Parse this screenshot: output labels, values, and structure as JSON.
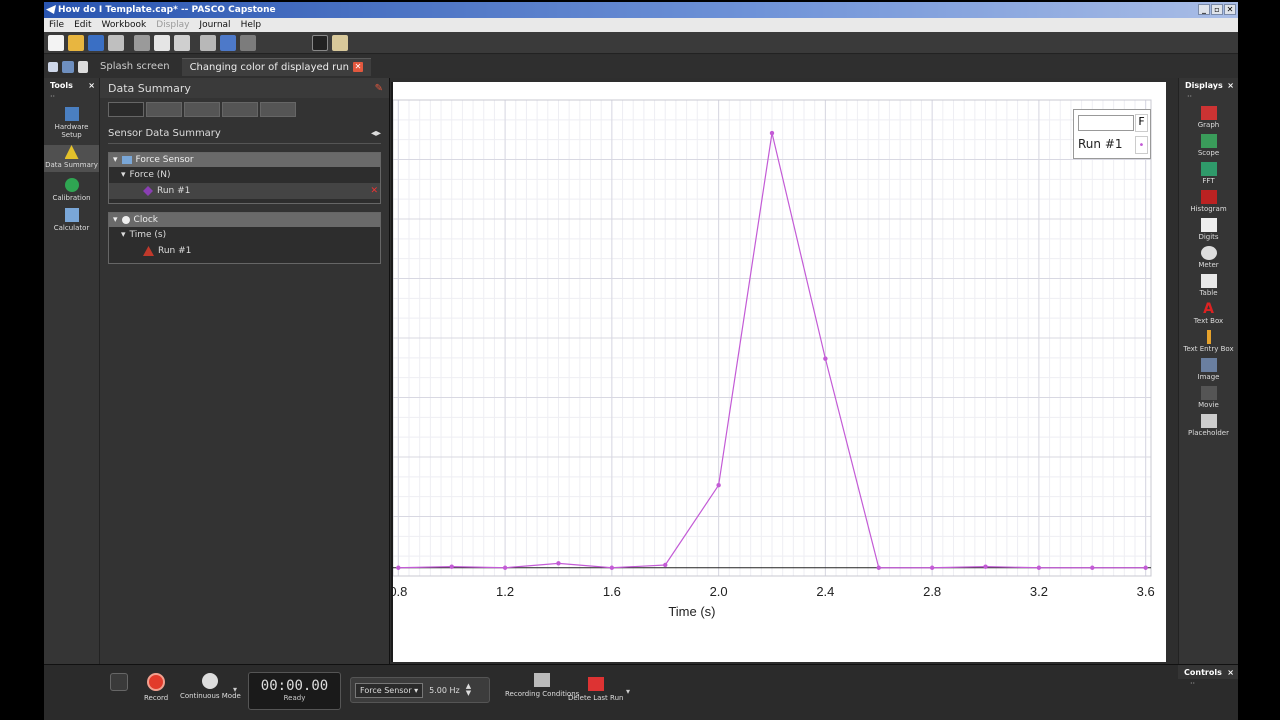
{
  "window": {
    "title": "How do I Template.cap* -- PASCO Capstone",
    "buttons": [
      "_",
      "▫",
      "✕"
    ]
  },
  "menu": [
    "File",
    "Edit",
    "Workbook",
    "Display",
    "Journal",
    "Help"
  ],
  "tabs": [
    {
      "label": "Splash screen",
      "active": false
    },
    {
      "label": "Changing color of displayed run",
      "active": true
    }
  ],
  "tools": {
    "title": "Tools",
    "close": "×",
    "items": [
      {
        "label": "Hardware Setup"
      },
      {
        "label": "Data Summary",
        "selected": true
      },
      {
        "label": "Calibration"
      },
      {
        "label": "Calculator"
      }
    ]
  },
  "summary": {
    "title": "Data Summary",
    "section": "Sensor Data Summary",
    "groups": [
      {
        "name": "Force Sensor",
        "measurement": "Force (N)",
        "run": "Run #1",
        "run_color": "#8a3fb3"
      },
      {
        "name": "Clock",
        "measurement": "Time (s)",
        "run": "Run #1",
        "run_color": "#c0392b"
      }
    ]
  },
  "graph": {
    "xlabel": "Time (s)",
    "legend": {
      "run": "Run #1",
      "header_suffix": "F"
    },
    "line_color": "#c35bd6"
  },
  "chart_data": {
    "type": "line",
    "title": "",
    "xlabel": "Time (s)",
    "ylabel": "",
    "xlim": [
      0.78,
      3.62
    ],
    "ylim": [
      -0.15,
      8.5
    ],
    "x_ticks": [
      "0.8",
      "1.2",
      "1.6",
      "2.0",
      "2.4",
      "2.8",
      "3.2",
      "3.6"
    ],
    "grid": true,
    "series": [
      {
        "name": "Run #1",
        "x": [
          0.8,
          1.0,
          1.2,
          1.4,
          1.6,
          1.8,
          2.0,
          2.2,
          2.4,
          2.6,
          2.8,
          3.0,
          3.2,
          3.4,
          3.6
        ],
        "values": [
          0.0,
          0.02,
          0.0,
          0.08,
          0.0,
          0.05,
          1.5,
          7.9,
          3.8,
          0.0,
          0.0,
          0.02,
          0.0,
          0.0,
          0.0
        ]
      }
    ]
  },
  "displays": {
    "title": "Displays",
    "close": "×",
    "items": [
      "Graph",
      "Scope",
      "FFT",
      "Histogram",
      "Digits",
      "Meter",
      "Table",
      "Text Box",
      "Text Entry Box",
      "Image",
      "Movie",
      "Placeholder"
    ]
  },
  "controls": {
    "record": "Record",
    "mode": "Continuous Mode",
    "time": "00:00.00",
    "status": "Ready",
    "sensor": "Force Sensor",
    "rate": "5.00 Hz",
    "recording_conditions": "Recording Conditions",
    "delete_last_run": "Delete Last Run",
    "panel_title": "Controls",
    "panel_close": "×"
  }
}
